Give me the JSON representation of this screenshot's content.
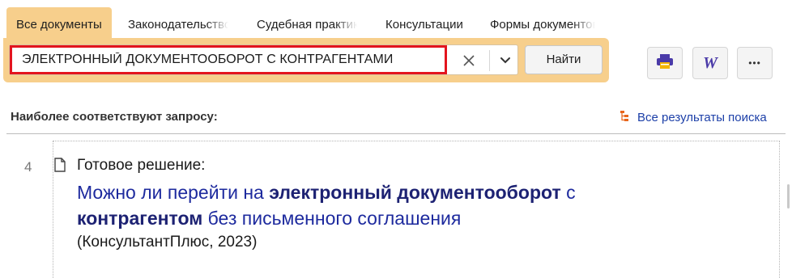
{
  "tabs": [
    {
      "label": "Все документы",
      "active": true
    },
    {
      "label": "Законодательство",
      "active": false
    },
    {
      "label": "Судебная практика",
      "active": false
    },
    {
      "label": "Консультации",
      "active": false
    },
    {
      "label": "Формы документов",
      "active": false
    }
  ],
  "search": {
    "value": "ЭЛЕКТРОННЫЙ ДОКУМЕНТООБОРОТ С КОНТРАГЕНТАМИ",
    "find_label": "Найти",
    "clear_icon": "close-icon",
    "dropdown_icon": "chevron-down-icon"
  },
  "toolbar": {
    "print_icon": "printer-icon",
    "word_icon": "word-icon",
    "word_glyph": "W",
    "more_icon": "more-icon",
    "more_glyph": "•••"
  },
  "results": {
    "section_title": "Наиболее соответствуют запросу:",
    "all_results_label": "Все результаты поиска",
    "items": [
      {
        "number": "4",
        "type": "Готовое решение:",
        "title_parts": [
          {
            "text": "Можно ли перейти на ",
            "bold": false
          },
          {
            "text": "электронный документооборот",
            "bold": true
          },
          {
            "text": " с ",
            "bold": false
          },
          {
            "text": "контрагентом",
            "bold": true
          },
          {
            "text": " без письменного соглашения",
            "bold": false
          }
        ],
        "source": "(КонсультантПлюс, 2023)"
      }
    ]
  },
  "colors": {
    "accent": "#f7cf8c",
    "highlight_border": "#e3141e",
    "link": "#1d2a9e",
    "link_bold": "#1d2273",
    "toolbar_icon": "#4a3aa8"
  }
}
